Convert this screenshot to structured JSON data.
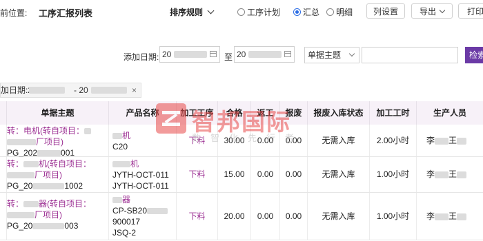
{
  "header": {
    "location_label": "前位置:",
    "title": "工序汇报列表",
    "sort_label": "排序规则",
    "radios": [
      {
        "label": "工序计划",
        "checked": false
      },
      {
        "label": "汇总",
        "checked": true
      },
      {
        "label": "明细",
        "checked": false
      }
    ],
    "buttons": {
      "columns": "列设置",
      "export": "导出",
      "print": "打印"
    }
  },
  "filter": {
    "date_label": "添加日期:",
    "date_from": "20",
    "to_label": "至",
    "date_to": "20",
    "subject_select": "单据主题",
    "search_input": "",
    "search_button": "检索",
    "tag_prefix": "加日期:20",
    "tag_sep": "- 20",
    "tag_close": "×"
  },
  "table": {
    "columns": [
      "单据主题",
      "产品名称",
      "加工工序",
      "合格",
      "返工",
      "报废",
      "报废入库状态",
      "加工工时",
      "生产人员"
    ],
    "rows": [
      {
        "subject_line1": "转：电机(转自项目：",
        "subject_line2": "厂项目)",
        "subject_code_prefix": "PG_202",
        "subject_code_suffix": "001",
        "product_line1": "机",
        "product_line2": "C20",
        "product_line3": "",
        "product_line4": "",
        "process": "下料",
        "qualified": "30.00",
        "rework": "0.00",
        "scrap": "0.00",
        "status": "无需入库",
        "hours": "2.00小时",
        "people_a": "李",
        "people_b": "王"
      },
      {
        "subject_line1": "转：",
        "subject_line1b": "机(转自项目：",
        "subject_line2": "厂项目)",
        "subject_code_prefix": "PG_20",
        "subject_code_suffix": "1002",
        "product_line1": "机",
        "product_line2": "JYTH-OCT-011",
        "product_line3": "JYTH-OCT-011",
        "product_line4": "",
        "process": "下料",
        "qualified": "15.00",
        "rework": "0.00",
        "scrap": "0.00",
        "status": "无需入库",
        "hours": "1.00小时",
        "people_a": "李",
        "people_b": "王"
      },
      {
        "subject_line1": "转：",
        "subject_line1b": "器(转自项目：",
        "subject_line2": "厂项目)",
        "subject_code_prefix": "PG_20",
        "subject_code_suffix": "003",
        "product_line1": "器",
        "product_line2": "CP-SB20",
        "product_line3": "900017",
        "product_line4": "JSQ-2",
        "process": "下料",
        "qualified": "20.00",
        "rework": "0.00",
        "scrap": "0.00",
        "status": "无需入库",
        "hours": "1.00小时",
        "people_a": "李",
        "people_b": "王"
      }
    ]
  },
  "watermark": {
    "title": "智邦国际",
    "subtitle": "数智化先行者"
  },
  "colors": {
    "accent": "#9b2d92",
    "search_button": "#6b3aa6",
    "radio_on": "#2b6de5",
    "watermark": "#e84a4a"
  }
}
